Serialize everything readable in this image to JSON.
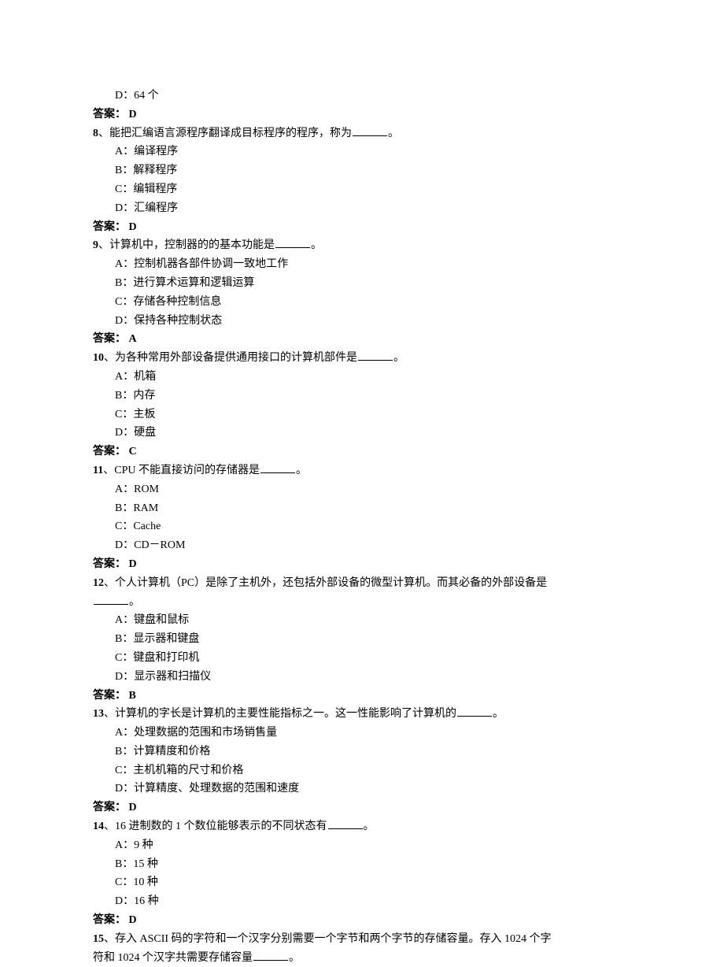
{
  "q7": {
    "optD": "D：64 个",
    "answer": "答案：  D"
  },
  "q8": {
    "num": "8",
    "sep": "、",
    "text_before": "能把汇编语言源程序翻译成目标程序的程序，称为",
    "text_after": "。",
    "optA": "A：编译程序",
    "optB": "B：解释程序",
    "optC": "C：编辑程序",
    "optD": "D：汇编程序",
    "answer": "答案：  D"
  },
  "q9": {
    "num": "9",
    "sep": "、",
    "text_before": "计算机中，控制器的的基本功能是",
    "text_after": "。",
    "optA": "A：控制机器各部件协调一致地工作",
    "optB": "B：进行算术运算和逻辑运算",
    "optC": "C：存储各种控制信息",
    "optD": "D：保持各种控制状态",
    "answer": "答案：  A"
  },
  "q10": {
    "num": "10",
    "sep": "、",
    "text_before": "为各种常用外部设备提供通用接口的计算机部件是",
    "text_after": "。",
    "optA": "A：机箱",
    "optB": "B：内存",
    "optC": "C：主板",
    "optD": "D：硬盘",
    "answer": "答案：  C"
  },
  "q11": {
    "num": "11",
    "sep": "、",
    "text_before": "CPU 不能直接访问的存储器是",
    "text_after": "。",
    "optA": "A：ROM",
    "optB": "B：RAM",
    "optC": "C：Cache",
    "optD": "D：CD－ROM",
    "answer": "答案：  D"
  },
  "q12": {
    "num": "12",
    "sep": "、",
    "text_line1": "个人计算机（PC）是除了主机外，还包括外部设备的微型计算机。而其必备的外部设备是",
    "text_after": "。",
    "optA": "A：键盘和鼠标",
    "optB": "B：显示器和键盘",
    "optC": "C：键盘和打印机",
    "optD": "D：显示器和扫描仪",
    "answer": "答案：  B"
  },
  "q13": {
    "num": "13",
    "sep": "、",
    "text_before": "计算机的字长是计算机的主要性能指标之一。这一性能影响了计算机的",
    "text_after": "。",
    "optA": "A：处理数据的范围和市场销售量",
    "optB": "B：计算精度和价格",
    "optC": "C：主机机箱的尺寸和价格",
    "optD": "D：计算精度、处理数据的范围和速度",
    "answer": "答案：  D"
  },
  "q14": {
    "num": "14",
    "sep": "、",
    "text_before": "16 进制数的 1 个数位能够表示的不同状态有",
    "text_after": "。",
    "optA": "A：9 种",
    "optB": "B：15 种",
    "optC": "C：10 种",
    "optD": "D：16 种",
    "answer": "答案：  D"
  },
  "q15": {
    "num": "15",
    "sep": "、",
    "text_line1": "存入 ASCII 码的字符和一个汉字分别需要一个字节和两个字节的存储容量。存入 1024 个字",
    "text_line2_before": "符和 1024 个汉字共需要存储容量",
    "text_after": "。"
  }
}
